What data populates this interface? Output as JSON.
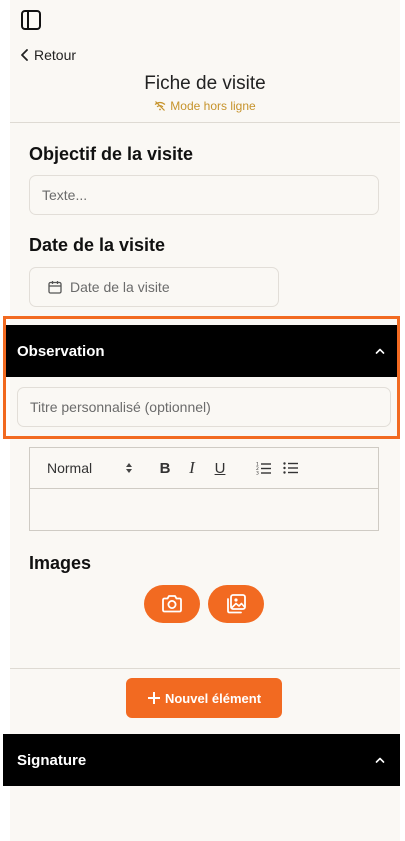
{
  "header": {
    "back_label": "Retour",
    "title": "Fiche de visite",
    "offline_label": "Mode hors ligne"
  },
  "form": {
    "objective": {
      "label": "Objectif de la visite",
      "placeholder": "Texte..."
    },
    "date": {
      "label": "Date de la visite",
      "placeholder": "Date de la visite"
    }
  },
  "observation": {
    "title": "Observation",
    "custom_title_placeholder": "Titre personnalisé (optionnel)",
    "editor": {
      "format_value": "Normal",
      "bold": "B",
      "italic": "I",
      "underline": "U"
    }
  },
  "images": {
    "label": "Images"
  },
  "actions": {
    "new_element_label": "Nouvel élément"
  },
  "signature": {
    "title": "Signature"
  },
  "colors": {
    "accent": "#f26a21",
    "offline": "#c6932b",
    "section_bar": "#000000",
    "background": "#faf8f4"
  },
  "icons": {
    "sidebar": "sidebar-toggle-icon",
    "back": "chevron-left-icon",
    "offline": "wifi-off-icon",
    "calendar": "calendar-icon",
    "collapse": "chevron-up-icon",
    "camera": "camera-icon",
    "gallery": "image-gallery-icon",
    "plus": "plus-icon",
    "ordered_list": "ordered-list-icon",
    "bullet_list": "bullet-list-icon"
  }
}
